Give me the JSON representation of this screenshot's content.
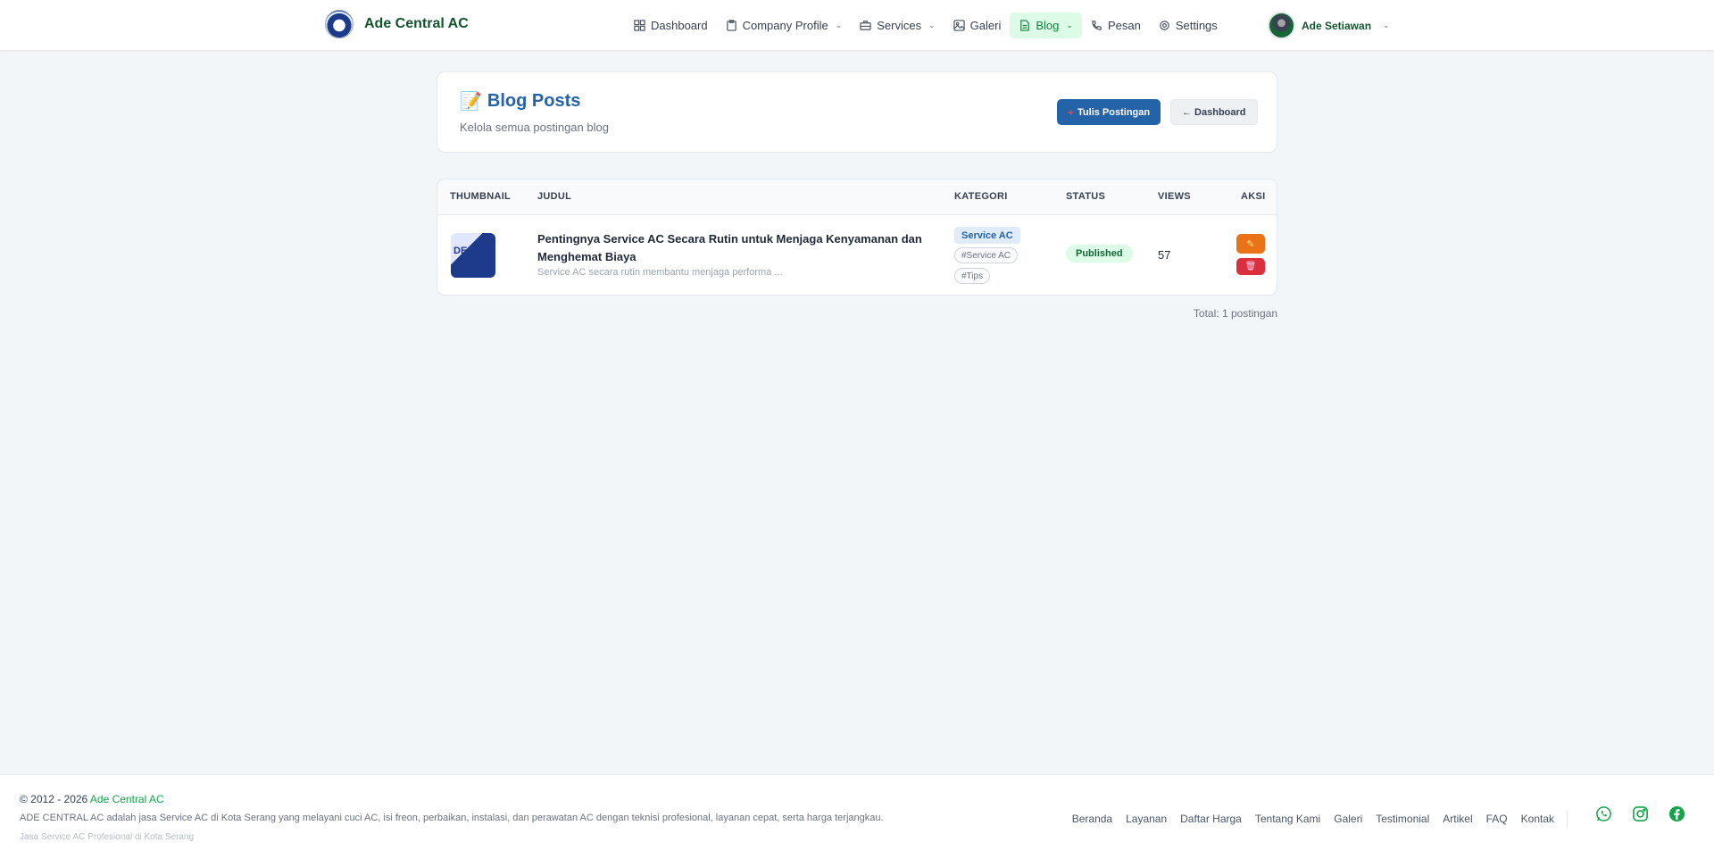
{
  "brand": {
    "name": "Ade Central AC"
  },
  "nav": {
    "items": [
      {
        "label": "Dashboard",
        "icon": "grid-icon",
        "dropdown": false,
        "active": false
      },
      {
        "label": "Company Profile",
        "icon": "clipboard-icon",
        "dropdown": true,
        "active": false
      },
      {
        "label": "Services",
        "icon": "briefcase-icon",
        "dropdown": true,
        "active": false
      },
      {
        "label": "Galeri",
        "icon": "image-icon",
        "dropdown": false,
        "active": false
      },
      {
        "label": "Blog",
        "icon": "file-icon",
        "dropdown": true,
        "active": true
      },
      {
        "label": "Pesan",
        "icon": "phone-icon",
        "dropdown": false,
        "active": false
      },
      {
        "label": "Settings",
        "icon": "gear-icon",
        "dropdown": false,
        "active": false
      }
    ],
    "user_name": "Ade Setiawan"
  },
  "header": {
    "emoji": "📝",
    "title": "Blog Posts",
    "subtitle": "Kelola semua postingan blog",
    "new_post_label": "Tulis Postingan",
    "back_label": "← Dashboard"
  },
  "table": {
    "columns": {
      "thumbnail": "THUMBNAIL",
      "title": "JUDUL",
      "category": "KATEGORI",
      "status": "STATUS",
      "views": "VIEWS",
      "actions": "AKSI"
    },
    "rows": [
      {
        "thumb_text": "DE",
        "title": "Pentingnya Service AC Secara Rutin untuk Menjaga Kenyamanan dan Menghemat Biaya",
        "excerpt": "Service AC secara rutin membantu menjaga performa ...",
        "category": "Service AC",
        "tags": [
          "#Service AC",
          "#Tips"
        ],
        "status": "Published",
        "views": "57"
      }
    ],
    "total": "Total: 1 postingan"
  },
  "footer": {
    "copyright_prefix": "© 2012 - 2026",
    "brand": "Ade Central AC",
    "description": "ADE CENTRAL AC adalah jasa Service AC di Kota Serang yang melayani cuci AC, isi freon, perbaikan, instalasi, dan perawatan AC dengan teknisi profesional, layanan cepat, serta harga terjangkau.",
    "tagline": "Jasa Service AC Profesional di Kota Serang",
    "links": [
      "Beranda",
      "Layanan",
      "Daftar Harga",
      "Tentang Kami",
      "Galeri",
      "Testimonial",
      "Artikel",
      "FAQ",
      "Kontak"
    ],
    "socials": [
      "whatsapp-icon",
      "instagram-icon",
      "facebook-icon"
    ]
  },
  "colors": {
    "primary": "#2563a8",
    "brand_green": "#16a34a",
    "edit": "#ea7317",
    "delete": "#dc2f3e"
  }
}
